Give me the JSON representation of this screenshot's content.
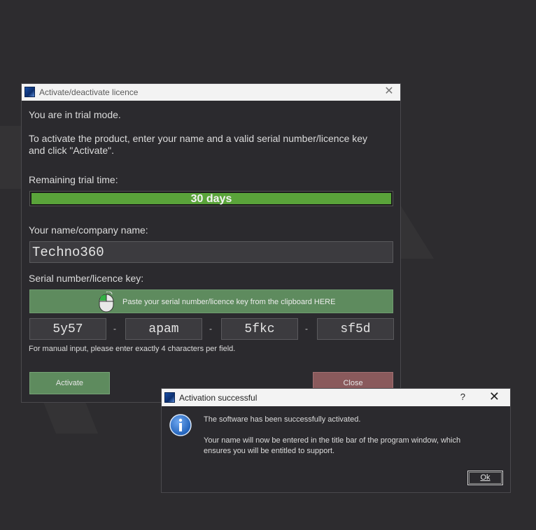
{
  "main_window": {
    "title": "Activate/deactivate licence",
    "trial_mode_text": "You are in trial mode.",
    "instruction_line1": "To activate the product, enter your name and a valid serial number/licence key",
    "instruction_line2": "and click \"Activate\".",
    "remaining_label": "Remaining trial time:",
    "remaining_value": "30 days",
    "remaining_fraction": 1.0,
    "name_label": "Your name/company name:",
    "name_value": "Techno360",
    "serial_label": "Serial number/licence key:",
    "paste_button_label": "Paste your serial number/licence key from the clipboard HERE",
    "serial_fields": [
      "5y57",
      "apam",
      "5fkc",
      "sf5d"
    ],
    "separator": "-",
    "manual_hint": "For manual input, please enter exactly 4 characters per field.",
    "activate_label": "Activate",
    "close_label": "Close"
  },
  "dialog": {
    "title": "Activation successful",
    "help_label": "?",
    "message_line1": "The software has been successfully activated.",
    "message_line2": "Your name will now be entered in the title bar of the program window, which",
    "message_line3": "ensures you will be entitled to support.",
    "ok_label": "Ok"
  },
  "colors": {
    "background": "#2d2c2f",
    "progress_fill": "#5aa43a",
    "activate_button": "#5e8b5e",
    "close_button": "#8a5a5c",
    "info_icon": "#1e5fb8"
  }
}
